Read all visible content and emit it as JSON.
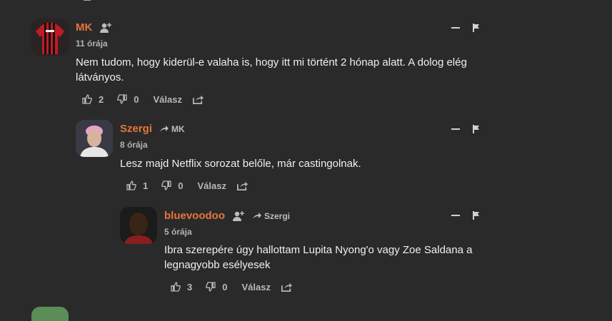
{
  "comments": [
    {
      "username": "MK",
      "time": "11 órája",
      "text": "Nem tudom, hogy kiderül-e valaha is, hogy itt mi történt 2 hónap alatt. A dolog elég látványos.",
      "likes": "2",
      "dislikes": "0",
      "reply_label": "Válasz"
    },
    {
      "username": "Szergi",
      "reply_to": "MK",
      "time": "8 órája",
      "text": "Lesz majd Netflix sorozat belőle, már castingolnak.",
      "likes": "1",
      "dislikes": "0",
      "reply_label": "Válasz"
    },
    {
      "username": "bluevoodoo",
      "reply_to": "Szergi",
      "time": "5 órája",
      "text": "Ibra szerepére úgy hallottam Lupita Nyong'o vagy Zoe Saldana a legnagyobb esélyesek",
      "likes": "3",
      "dislikes": "0",
      "reply_label": "Válasz"
    }
  ],
  "colors": {
    "username": "#e8743b",
    "background": "#2a2a2a"
  }
}
